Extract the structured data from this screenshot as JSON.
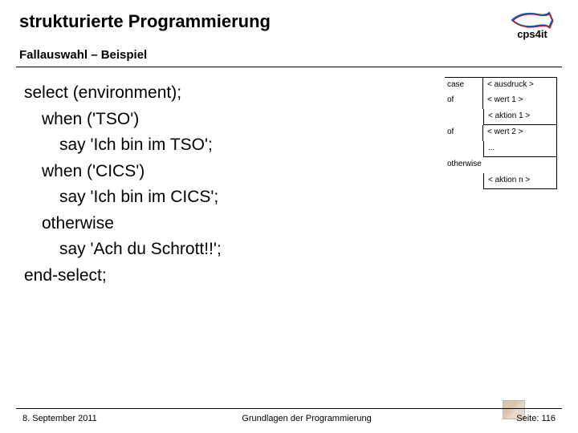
{
  "header": {
    "title": "strukturierte Programmierung",
    "logo_text": "cps4it"
  },
  "subtitle": "Fallauswahl – Beispiel",
  "code": {
    "l0": "select (environment);",
    "l1": "when ('TSO')",
    "l2": "say 'Ich bin im TSO';",
    "l3": "when ('CICS')",
    "l4": "say 'Ich bin im CICS';",
    "l5": "otherwise",
    "l6": "say 'Ach du Schrott!!';",
    "l7": "end-select;"
  },
  "diagram": {
    "r0_label": "case",
    "r0_content": "< ausdruck >",
    "r1_label": "of",
    "r1_content": "< wert 1 >",
    "r1_box": "< aktion 1 >",
    "r2_label": "of",
    "r2_content": "< wert 2 >",
    "r2_box": "...",
    "r3_label": "otherwise",
    "r3_box": "< aktion n >"
  },
  "footer": {
    "date": "8. September 2011",
    "center": "Grundlagen der Programmierung",
    "page": "Seite: 116"
  }
}
